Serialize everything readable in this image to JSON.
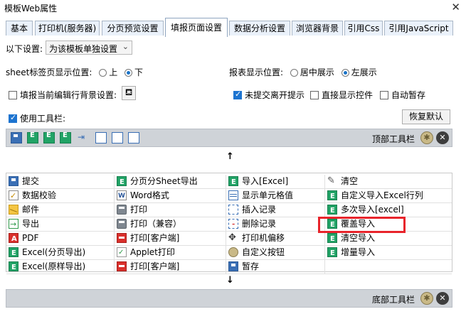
{
  "window": {
    "title": "模板Web属性"
  },
  "tabs": [
    "基本",
    "打印机(服务器)",
    "分页预览设置",
    "填报页面设置",
    "数据分析设置",
    "浏览器背景",
    "引用Css",
    "引用JavaScript"
  ],
  "active_tab": "填报页面设置",
  "settings": {
    "scope_label": "以下设置:",
    "scope_value": "为该模板单独设置",
    "sheet_pos_label": "sheet标签页显示位置:",
    "sheet_pos_up": "上",
    "sheet_pos_down": "下",
    "report_pos_label": "报表显示位置:",
    "report_pos_center": "居中展示",
    "report_pos_left": "左展示",
    "row_bg_label": "填报当前编辑行背景设置:",
    "unsubmitted_label": "未提交离开提示",
    "direct_show_label": "直接显示控件",
    "auto_save_label": "自动暂存",
    "use_toolbar_label": "使用工具栏:",
    "restore_default": "恢复默认"
  },
  "top_toolbar": {
    "label": "顶部工具栏",
    "icons": [
      "save-icon",
      "excel-icon",
      "excel-icon",
      "excel-icon",
      "insert-icon",
      "blank-icon",
      "blank-icon",
      "blank-icon"
    ]
  },
  "bottom_toolbar": {
    "label": "底部工具栏"
  },
  "buttons": {
    "col1": [
      "提交",
      "数据校验",
      "邮件",
      "导出",
      "PDF",
      "Excel(分页导出)",
      "Excel(原样导出)"
    ],
    "col2": [
      "分页分Sheet导出",
      "Word格式",
      "打印",
      "打印（兼容）",
      "打印[客户端]",
      "Applet打印",
      "打印[客户端]"
    ],
    "col3": [
      "导入[Excel]",
      "显示单元格值",
      "插入记录",
      "删除记录",
      "打印机偏移",
      "自定义按钮",
      "暂存"
    ],
    "col4": [
      "清空",
      "自定义导入Excel行列",
      "多次导入[excel]",
      "覆盖导入",
      "清空导入",
      "增量导入"
    ]
  },
  "icons": {
    "col1": [
      "save-icon",
      "check-icon",
      "mail-icon",
      "export-icon",
      "pdf-icon",
      "excel-icon",
      "excel-icon"
    ],
    "col2": [
      "excel-icon",
      "word-icon",
      "print-icon",
      "print-icon",
      "print-red-icon",
      "applet-icon",
      "print-red-icon"
    ],
    "col3": [
      "excel-icon",
      "grid-icon",
      "insert-icon",
      "delete-icon",
      "move-icon",
      "gear-icon",
      "draft-icon"
    ],
    "col4": [
      "clear-icon",
      "excel-icon",
      "excel-icon",
      "excel-icon",
      "excel-icon",
      "excel-icon"
    ]
  },
  "colors": {
    "highlight": "#e8242b",
    "toolbar_bg": "#cfd3d8",
    "active_tab_border": "#8fa5c0"
  }
}
